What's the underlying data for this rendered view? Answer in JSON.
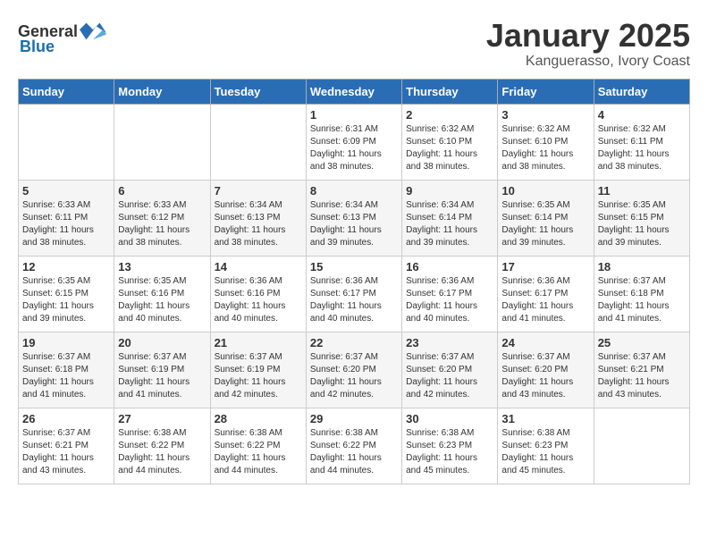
{
  "header": {
    "logo_general": "General",
    "logo_blue": "Blue",
    "title": "January 2025",
    "subtitle": "Kanguerasso, Ivory Coast"
  },
  "days_of_week": [
    "Sunday",
    "Monday",
    "Tuesday",
    "Wednesday",
    "Thursday",
    "Friday",
    "Saturday"
  ],
  "weeks": [
    [
      {
        "day": "",
        "info": ""
      },
      {
        "day": "",
        "info": ""
      },
      {
        "day": "",
        "info": ""
      },
      {
        "day": "1",
        "info": "Sunrise: 6:31 AM\nSunset: 6:09 PM\nDaylight: 11 hours\nand 38 minutes."
      },
      {
        "day": "2",
        "info": "Sunrise: 6:32 AM\nSunset: 6:10 PM\nDaylight: 11 hours\nand 38 minutes."
      },
      {
        "day": "3",
        "info": "Sunrise: 6:32 AM\nSunset: 6:10 PM\nDaylight: 11 hours\nand 38 minutes."
      },
      {
        "day": "4",
        "info": "Sunrise: 6:32 AM\nSunset: 6:11 PM\nDaylight: 11 hours\nand 38 minutes."
      }
    ],
    [
      {
        "day": "5",
        "info": "Sunrise: 6:33 AM\nSunset: 6:11 PM\nDaylight: 11 hours\nand 38 minutes."
      },
      {
        "day": "6",
        "info": "Sunrise: 6:33 AM\nSunset: 6:12 PM\nDaylight: 11 hours\nand 38 minutes."
      },
      {
        "day": "7",
        "info": "Sunrise: 6:34 AM\nSunset: 6:13 PM\nDaylight: 11 hours\nand 38 minutes."
      },
      {
        "day": "8",
        "info": "Sunrise: 6:34 AM\nSunset: 6:13 PM\nDaylight: 11 hours\nand 39 minutes."
      },
      {
        "day": "9",
        "info": "Sunrise: 6:34 AM\nSunset: 6:14 PM\nDaylight: 11 hours\nand 39 minutes."
      },
      {
        "day": "10",
        "info": "Sunrise: 6:35 AM\nSunset: 6:14 PM\nDaylight: 11 hours\nand 39 minutes."
      },
      {
        "day": "11",
        "info": "Sunrise: 6:35 AM\nSunset: 6:15 PM\nDaylight: 11 hours\nand 39 minutes."
      }
    ],
    [
      {
        "day": "12",
        "info": "Sunrise: 6:35 AM\nSunset: 6:15 PM\nDaylight: 11 hours\nand 39 minutes."
      },
      {
        "day": "13",
        "info": "Sunrise: 6:35 AM\nSunset: 6:16 PM\nDaylight: 11 hours\nand 40 minutes."
      },
      {
        "day": "14",
        "info": "Sunrise: 6:36 AM\nSunset: 6:16 PM\nDaylight: 11 hours\nand 40 minutes."
      },
      {
        "day": "15",
        "info": "Sunrise: 6:36 AM\nSunset: 6:17 PM\nDaylight: 11 hours\nand 40 minutes."
      },
      {
        "day": "16",
        "info": "Sunrise: 6:36 AM\nSunset: 6:17 PM\nDaylight: 11 hours\nand 40 minutes."
      },
      {
        "day": "17",
        "info": "Sunrise: 6:36 AM\nSunset: 6:17 PM\nDaylight: 11 hours\nand 41 minutes."
      },
      {
        "day": "18",
        "info": "Sunrise: 6:37 AM\nSunset: 6:18 PM\nDaylight: 11 hours\nand 41 minutes."
      }
    ],
    [
      {
        "day": "19",
        "info": "Sunrise: 6:37 AM\nSunset: 6:18 PM\nDaylight: 11 hours\nand 41 minutes."
      },
      {
        "day": "20",
        "info": "Sunrise: 6:37 AM\nSunset: 6:19 PM\nDaylight: 11 hours\nand 41 minutes."
      },
      {
        "day": "21",
        "info": "Sunrise: 6:37 AM\nSunset: 6:19 PM\nDaylight: 11 hours\nand 42 minutes."
      },
      {
        "day": "22",
        "info": "Sunrise: 6:37 AM\nSunset: 6:20 PM\nDaylight: 11 hours\nand 42 minutes."
      },
      {
        "day": "23",
        "info": "Sunrise: 6:37 AM\nSunset: 6:20 PM\nDaylight: 11 hours\nand 42 minutes."
      },
      {
        "day": "24",
        "info": "Sunrise: 6:37 AM\nSunset: 6:20 PM\nDaylight: 11 hours\nand 43 minutes."
      },
      {
        "day": "25",
        "info": "Sunrise: 6:37 AM\nSunset: 6:21 PM\nDaylight: 11 hours\nand 43 minutes."
      }
    ],
    [
      {
        "day": "26",
        "info": "Sunrise: 6:37 AM\nSunset: 6:21 PM\nDaylight: 11 hours\nand 43 minutes."
      },
      {
        "day": "27",
        "info": "Sunrise: 6:38 AM\nSunset: 6:22 PM\nDaylight: 11 hours\nand 44 minutes."
      },
      {
        "day": "28",
        "info": "Sunrise: 6:38 AM\nSunset: 6:22 PM\nDaylight: 11 hours\nand 44 minutes."
      },
      {
        "day": "29",
        "info": "Sunrise: 6:38 AM\nSunset: 6:22 PM\nDaylight: 11 hours\nand 44 minutes."
      },
      {
        "day": "30",
        "info": "Sunrise: 6:38 AM\nSunset: 6:23 PM\nDaylight: 11 hours\nand 45 minutes."
      },
      {
        "day": "31",
        "info": "Sunrise: 6:38 AM\nSunset: 6:23 PM\nDaylight: 11 hours\nand 45 minutes."
      },
      {
        "day": "",
        "info": ""
      }
    ]
  ]
}
